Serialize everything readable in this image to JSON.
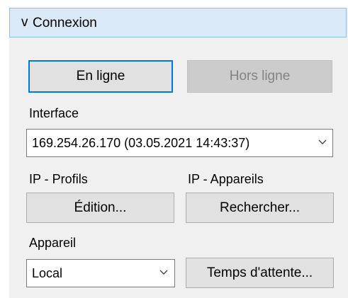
{
  "section": {
    "title": "Connexion",
    "chevron": "v"
  },
  "buttons": {
    "online": "En ligne",
    "offline": "Hors ligne",
    "edit": "Édition...",
    "search": "Rechercher...",
    "timeout": "Temps d'attente..."
  },
  "interface": {
    "label": "Interface",
    "value": "169.254.26.170 (03.05.2021 14:43:37)"
  },
  "ip_profiles": {
    "label": "IP - Profils"
  },
  "ip_devices": {
    "label": "IP - Appareils"
  },
  "device": {
    "label": "Appareil",
    "value": "Local"
  },
  "icons": {
    "dropdown": "chevron-down-icon"
  }
}
